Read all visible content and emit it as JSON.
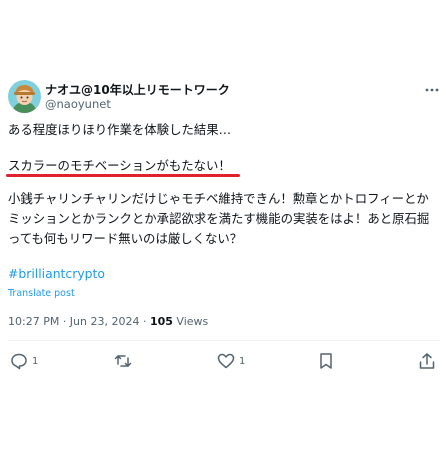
{
  "post": {
    "author": {
      "display_name": "ナオユ@10年以上リモートワーク",
      "handle": "@naoyunet"
    },
    "body": {
      "line1": "ある程度ほりほり作業を体験した結果…",
      "line2": "スカラーのモチベーションがもたない！",
      "paragraph3": "小銭チャリンチャリンだけじゃモチベ維持できん！勲章とかトロフィーとかミッションとかランクとか承認欲求を満たす機能の実装をはよ！あと原石掘っても何もリワード無いのは厳しくない？"
    },
    "hashtag": "#brilliantcrypto",
    "translate_label": "Translate post",
    "meta": {
      "timestamp": "10:27 PM · Jun 23, 2024 · ",
      "views_count": "105",
      "views_label": " Views"
    },
    "actions": {
      "reply_count": "1",
      "like_count": "1"
    },
    "colors": {
      "accent": "#1d9bf0",
      "highlight_underline": "#e0202a",
      "secondary_text": "#536471"
    },
    "icons": [
      "avatar",
      "more-icon",
      "reply-icon",
      "repost-icon",
      "like-icon",
      "bookmark-icon",
      "share-icon"
    ]
  }
}
